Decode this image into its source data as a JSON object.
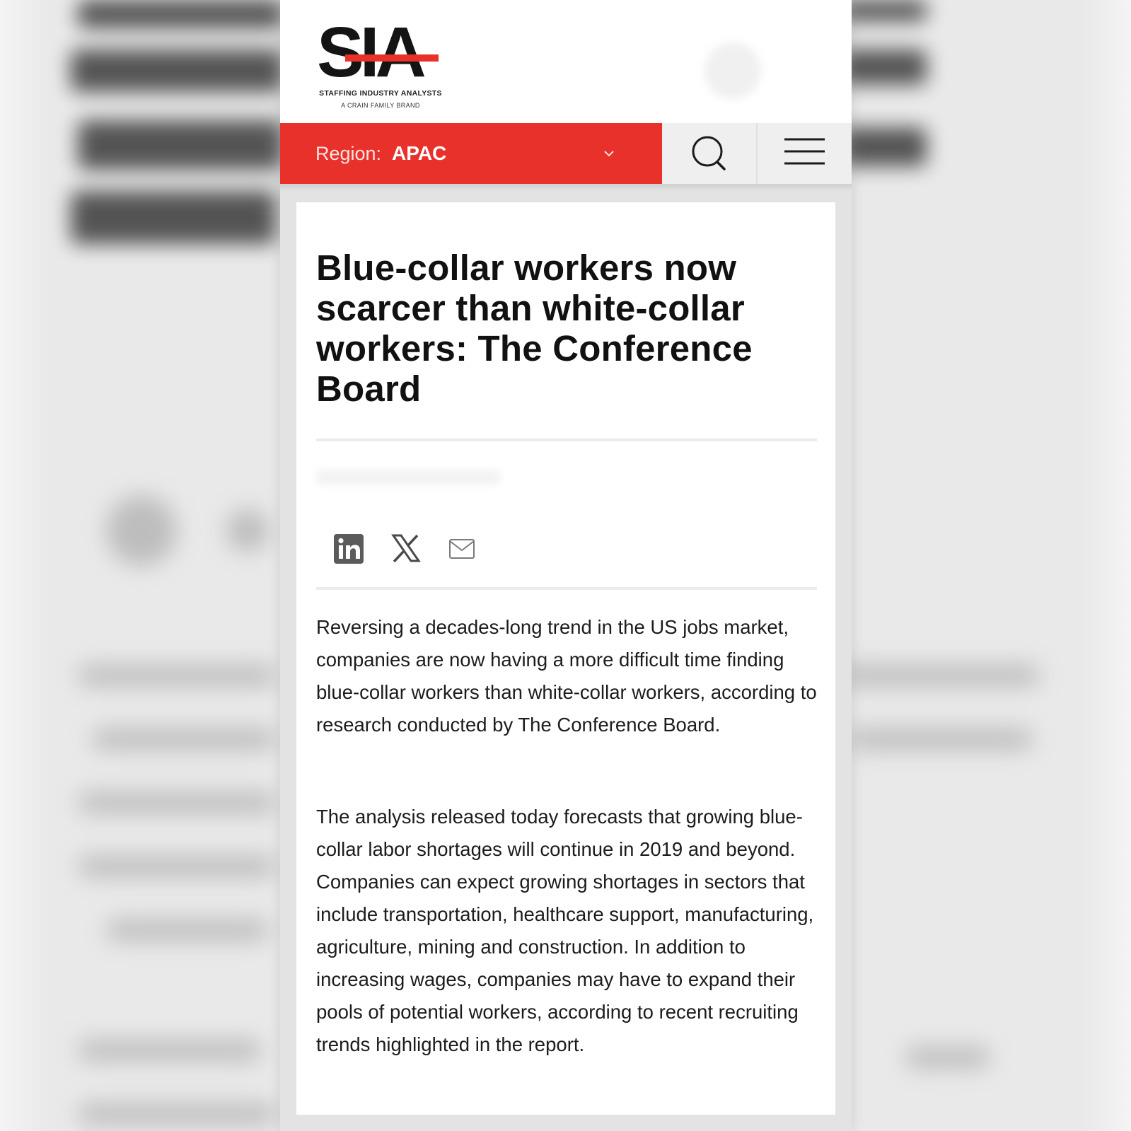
{
  "brand": {
    "logo_text": "SIA",
    "tagline": "STAFFING INDUSTRY ANALYSTS",
    "sub_tagline": "A CRAIN FAMILY BRAND",
    "accent_color": "#e8312a"
  },
  "nav": {
    "region_label": "Region:",
    "region_value": "APAC",
    "region_chevron_icon": "chevron-down-icon",
    "search_icon": "search-icon",
    "menu_icon": "hamburger-menu-icon"
  },
  "article": {
    "title": "Blue-collar workers now scarcer than white-collar workers: The Conference Board",
    "share_icons": [
      "linkedin-icon",
      "x-icon",
      "email-icon"
    ],
    "paragraphs": [
      "Reversing a decades-long trend in the US jobs market, companies are now having a more difficult time finding blue-collar workers than white-collar workers, according to research conducted by The Conference Board.",
      "The analysis released today forecasts that growing blue-collar labor shortages will continue in 2019 and beyond. Companies can expect growing shortages in sectors that include transportation, healthcare support, manufacturing, agriculture, mining and construction. In addition to increasing wages, companies may have to expand their pools of potential workers, according to recent recruiting trends highlighted in the report."
    ]
  }
}
